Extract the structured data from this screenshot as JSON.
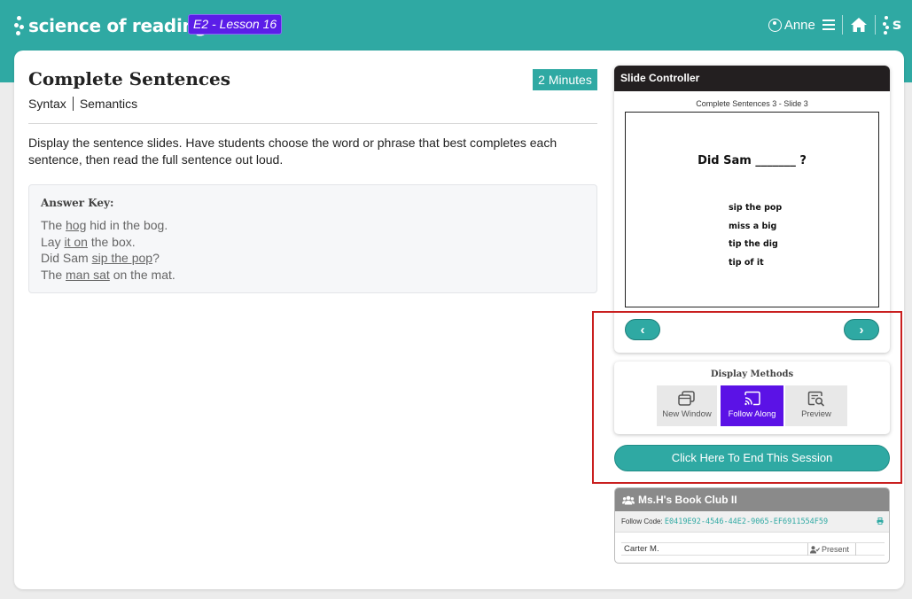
{
  "header": {
    "brand": "science of reading",
    "lesson_badge": "E2 - Lesson 16",
    "user_name": "Anne",
    "mini_brand": "s"
  },
  "lesson": {
    "title": "Complete Sentences",
    "duration": "2 Minutes",
    "tags": [
      "Syntax",
      "Semantics"
    ],
    "instructions": "Display the sentence slides. Have students choose the word or phrase that best completes each sentence, then read the full sentence out loud.",
    "answer_key": {
      "title": "Answer Key:",
      "lines": [
        {
          "pre": "The ",
          "answer": "hog",
          "post": " hid in the bog."
        },
        {
          "pre": "Lay ",
          "answer": "it on",
          "post": " the box."
        },
        {
          "pre": "Did Sam ",
          "answer": "sip the pop",
          "post": "?"
        },
        {
          "pre": "The ",
          "answer": "man sat",
          "post": " on the mat."
        }
      ]
    }
  },
  "slide_controller": {
    "title": "Slide Controller",
    "caption": "Complete Sentences 3 - Slide 3",
    "slide": {
      "question": "Did Sam _______ ?",
      "options": [
        "sip the pop",
        "miss a big",
        "tip the dig",
        "tip of it"
      ]
    },
    "prev_glyph": "‹",
    "next_glyph": "›"
  },
  "display_methods": {
    "title": "Display Methods",
    "new_window": "New Window",
    "follow_along": "Follow Along",
    "preview": "Preview",
    "active": "Follow Along",
    "active_color": "#5b12e6"
  },
  "end_session_label": "Click Here To End This Session",
  "club": {
    "name": "Ms.H's Book Club II",
    "follow_code_label": "Follow Code:",
    "follow_code": "E0419E92-4546-44E2-9065-EF6911554F59",
    "students": [
      {
        "name": "Carter M.",
        "status": "Present"
      }
    ]
  },
  "colors": {
    "teal": "#2fa9a3",
    "purple": "#5b1ee8",
    "highlight_red": "#c91f1f"
  }
}
